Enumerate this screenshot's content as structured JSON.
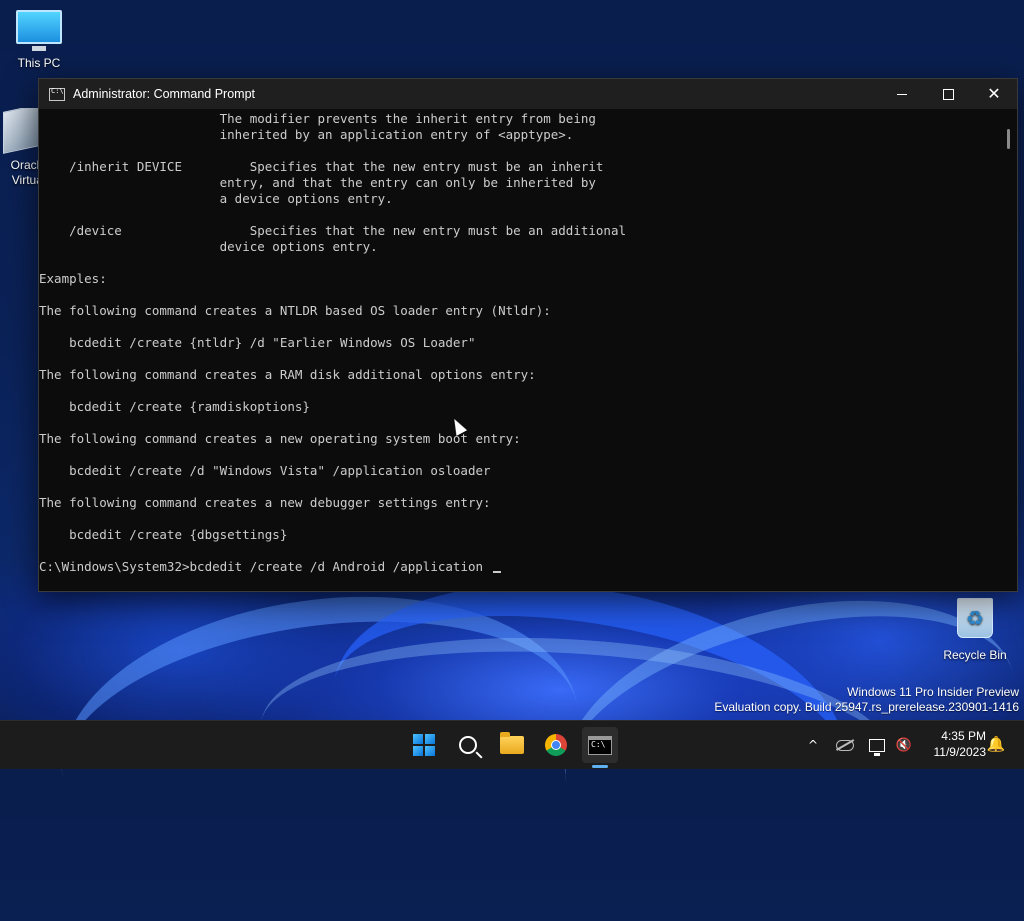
{
  "desktop": {
    "icons": [
      {
        "label": "This PC"
      },
      {
        "label": "Oracle VM VirtualBox"
      },
      {
        "label": "Recycle Bin"
      }
    ],
    "watermark": {
      "line1": "Windows 11 Pro Insider Preview",
      "line2": "Evaluation copy. Build 25947.rs_prerelease.230901-1416"
    }
  },
  "window": {
    "title": "Administrator: Command Prompt",
    "minimize_glyph": "",
    "close_glyph": "✕",
    "console_lines": [
      "                        The modifier prevents the inherit entry from being",
      "                        inherited by an application entry of <apptype>.",
      "",
      "    /inherit DEVICE         Specifies that the new entry must be an inherit",
      "                        entry, and that the entry can only be inherited by",
      "                        a device options entry.",
      "",
      "    /device                 Specifies that the new entry must be an additional",
      "                        device options entry.",
      "",
      "Examples:",
      "",
      "The following command creates a NTLDR based OS loader entry (Ntldr):",
      "",
      "    bcdedit /create {ntldr} /d \"Earlier Windows OS Loader\"",
      "",
      "The following command creates a RAM disk additional options entry:",
      "",
      "    bcdedit /create {ramdiskoptions}",
      "",
      "The following command creates a new operating system boot entry:",
      "",
      "    bcdedit /create /d \"Windows Vista\" /application osloader",
      "",
      "The following command creates a new debugger settings entry:",
      "",
      "    bcdedit /create {dbgsettings}",
      ""
    ],
    "prompt": "C:\\Windows\\System32>",
    "command_input": "bcdedit /create /d Android /application "
  },
  "taskbar": {
    "apps": [
      {
        "name": "start",
        "icon": "windows-logo-icon"
      },
      {
        "name": "search",
        "icon": "search-icon"
      },
      {
        "name": "file-explorer",
        "icon": "folder-icon"
      },
      {
        "name": "chrome",
        "icon": "chrome-icon"
      },
      {
        "name": "command-prompt",
        "icon": "terminal-icon",
        "active": true
      }
    ],
    "tray": {
      "chevron": "^",
      "volume_glyph": "🔇",
      "time": "4:35 PM",
      "date": "11/9/2023",
      "bell_glyph": "🔔"
    }
  },
  "colors": {
    "console_bg": "#0c0c0c",
    "console_fg": "#cccccc",
    "accent": "#4cc2ff"
  }
}
